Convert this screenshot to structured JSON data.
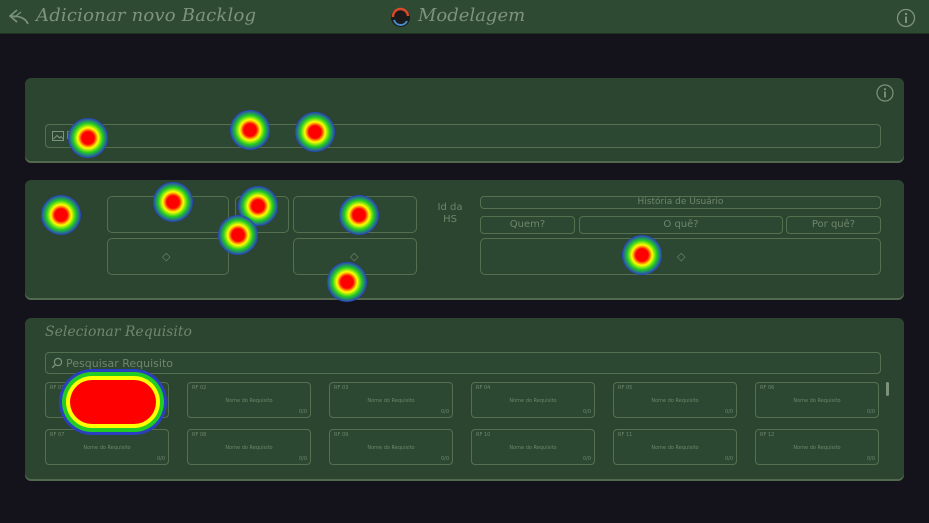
{
  "topbar": {
    "title": "Adicionar novo Backlog",
    "app_name": "Modelagem",
    "back_icon": "back-arrow-icon",
    "logo_icon": "app-logo-icon",
    "info_icon": "info-icon"
  },
  "backlog_section": {
    "info_icon": "info-icon",
    "field_icon": "image-icon",
    "field_text": "B"
  },
  "hs_section": {
    "id_label_line1": "Id da",
    "id_label_line2": "HS",
    "user_story_header": "História de Usuário",
    "who": "Quem?",
    "what": "O quê?",
    "why": "Por quê?",
    "chevron": "◇"
  },
  "requirements": {
    "title": "Selecionar Requisito",
    "search_placeholder": "Pesquisar Requisito",
    "cards": [
      {
        "id": "RF 01",
        "name": "Nome do Requisito",
        "count": "0/0"
      },
      {
        "id": "RF 02",
        "name": "Nome do Requisito",
        "count": "0/0"
      },
      {
        "id": "RF 03",
        "name": "Nome do Requisito",
        "count": "0/0"
      },
      {
        "id": "RF 04",
        "name": "Nome do Requisito",
        "count": "0/0"
      },
      {
        "id": "RF 05",
        "name": "Nome do Requisito",
        "count": "0/0"
      },
      {
        "id": "RF 06",
        "name": "Nome do Requisito",
        "count": "0/0"
      },
      {
        "id": "RF 07",
        "name": "Nome do Requisito",
        "count": "0/0"
      },
      {
        "id": "RF 08",
        "name": "Nome do Requisito",
        "count": "0/0"
      },
      {
        "id": "RF 09",
        "name": "Nome do Requisito",
        "count": "0/0"
      },
      {
        "id": "RF 10",
        "name": "Nome do Requisito",
        "count": "0/0"
      },
      {
        "id": "RF 11",
        "name": "Nome do Requisito",
        "count": "0/0"
      },
      {
        "id": "RF 12",
        "name": "Nome do Requisito",
        "count": "0/0"
      }
    ]
  },
  "colors": {
    "background": "#14121b",
    "topbar": "#2f4a33",
    "panel": "#2b4530",
    "border": "#55704f",
    "text": "#6e866b"
  }
}
